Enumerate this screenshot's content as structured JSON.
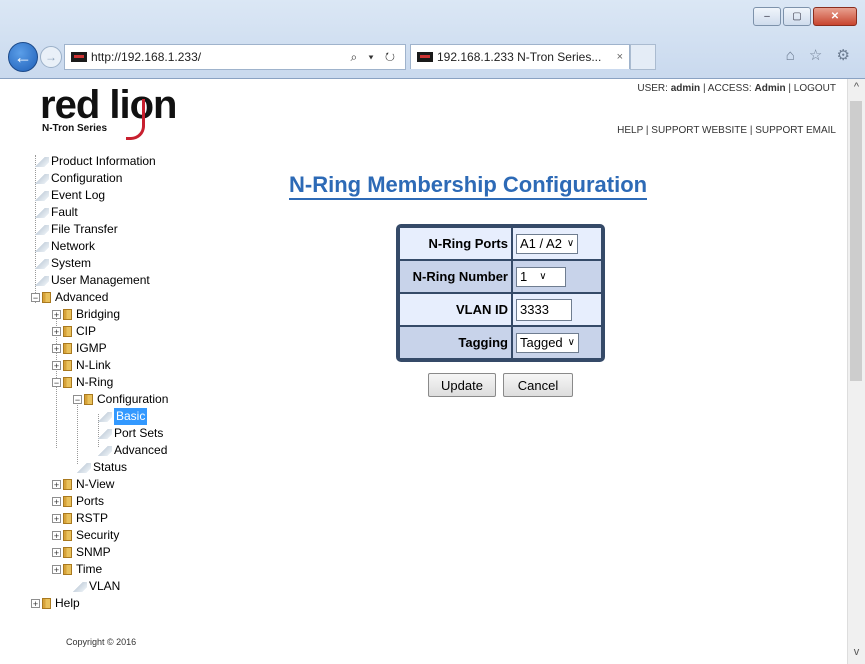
{
  "browser": {
    "url": "http://192.168.1.233/",
    "tab_title": "192.168.1.233 N-Tron Series...",
    "tab_close": "×",
    "addr_icons": "⌕ ▾ ↻",
    "toolbar_icons": "⌂ ☆ ⚙",
    "window_controls": [
      "–",
      "▢",
      "✕"
    ]
  },
  "header": {
    "logo_text": "red lion",
    "logo_sub": "N-Tron Series",
    "user_label": "USER:",
    "user": "admin",
    "access_label": "ACCESS:",
    "access": "Admin",
    "logout": "LOGOUT",
    "help": "HELP",
    "support_website": "SUPPORT WEBSITE",
    "support_email": "SUPPORT EMAIL",
    "separator": "|"
  },
  "tree": {
    "product_information": "Product Information",
    "configuration": "Configuration",
    "event_log": "Event Log",
    "fault": "Fault",
    "file_transfer": "File Transfer",
    "network": "Network",
    "system": "System",
    "user_management": "User Management",
    "advanced": "Advanced",
    "bridging": "Bridging",
    "cip": "CIP",
    "igmp": "IGMP",
    "nlink": "N-Link",
    "nring": "N-Ring",
    "nring_configuration": "Configuration",
    "basic": "Basic",
    "port_sets": "Port Sets",
    "nring_advanced": "Advanced",
    "status": "Status",
    "nview": "N-View",
    "ports": "Ports",
    "rstp": "RSTP",
    "security": "Security",
    "snmp": "SNMP",
    "time": "Time",
    "vlan": "VLAN",
    "help": "Help",
    "expander_plus": "+",
    "expander_minus": "−"
  },
  "copyright": "Copyright © 2016",
  "main": {
    "title": "N-Ring Membership Configuration",
    "fields": {
      "ring_ports_label": "N-Ring Ports",
      "ring_ports_value": "A1 / A2",
      "ring_number_label": "N-Ring Number",
      "ring_number_value": "1",
      "vlan_id_label": "VLAN ID",
      "vlan_id_value": "3333",
      "tagging_label": "Tagging",
      "tagging_value": "Tagged"
    },
    "update_button": "Update",
    "cancel_button": "Cancel",
    "chevron": "∨"
  },
  "colors": {
    "title_blue": "#2d6ab6",
    "table_border": "#354a68",
    "row_light": "#e7eefd",
    "row_dark": "#c8d3ea",
    "selection": "#3399ff",
    "brand_red": "#c8202f"
  }
}
